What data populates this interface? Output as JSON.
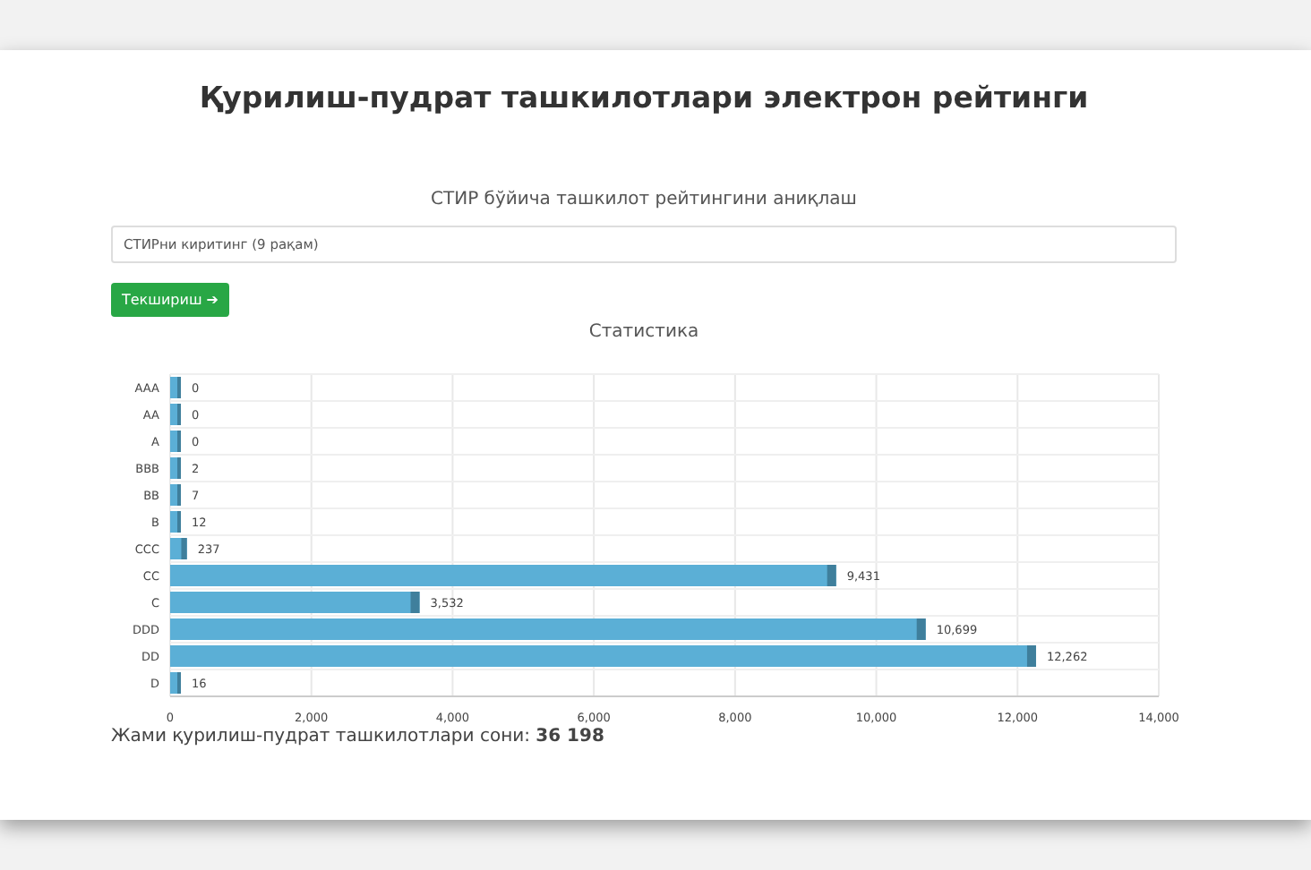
{
  "title": "Қурилиш-пудрат ташкилотлари электрон рейтинги",
  "search": {
    "heading": "СТИР бўйича ташкилот рейтингини аниқлаш",
    "placeholder": "СТИРни киритинг (9 рақам)",
    "button": "Текшириш",
    "button_icon": "➔"
  },
  "statistics": {
    "heading": "Статистика",
    "chart_data": {
      "type": "bar",
      "orientation": "horizontal",
      "categories": [
        "AAA",
        "AA",
        "A",
        "BBB",
        "BB",
        "B",
        "CCC",
        "CC",
        "C",
        "DDD",
        "DD",
        "D"
      ],
      "grid": true,
      "series": [
        {
          "color": "#5bafd6",
          "values": [
            0,
            0,
            0,
            2,
            7,
            12,
            237,
            9431,
            3532,
            10699,
            12262,
            16
          ]
        }
      ],
      "value_labels": [
        "0",
        "0",
        "0",
        "2",
        "7",
        "12",
        "237",
        "9,431",
        "3,532",
        "10,699",
        "12,262",
        "16"
      ],
      "xlim": [
        0,
        14000
      ],
      "xticks": [
        {
          "value": 0,
          "label": "0"
        },
        {
          "value": 2000,
          "label": "2,000"
        },
        {
          "value": 4000,
          "label": "4,000"
        },
        {
          "value": 6000,
          "label": "6,000"
        },
        {
          "value": 8000,
          "label": "8,000"
        },
        {
          "value": 10000,
          "label": "10,000"
        },
        {
          "value": 12000,
          "label": "12,000"
        },
        {
          "value": 14000,
          "label": "14,000"
        }
      ]
    },
    "total": "Жами қурилиш-пудрат ташкилотлари сони: **36 198**"
  }
}
